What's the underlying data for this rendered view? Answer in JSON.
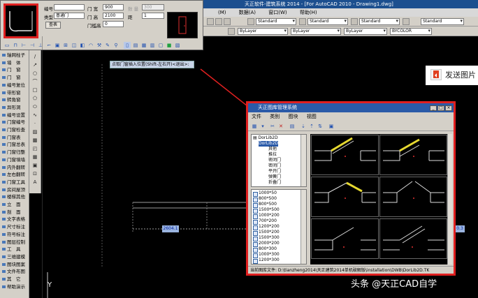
{
  "app": {
    "title": "天正软件-建筑系统 2014 - [For AutoCAD 2010 - Drawing1.dwg]"
  },
  "menu": [
    "(M)",
    "数据(A)",
    "窗口(W)",
    "帮助(H)"
  ],
  "toolbar": {
    "text_style": "Standard",
    "dim_style": "Standard",
    "table_style": "Standard",
    "multileader_style": "Standard",
    "layer": "ByLayer",
    "linetype": "ByLayer",
    "lineweight": "ByLayer",
    "color": "BYCOLOR"
  },
  "insert_dialog": {
    "number_label": "编号",
    "number_value": "",
    "type_label": "类型",
    "type_value": "普通门",
    "table_button": "查表",
    "width_label": "门 宽",
    "width_value": "900",
    "height_label": "门 高",
    "height_value": "2100",
    "sill_label": "门槛高",
    "sill_value": "0",
    "count_label": "数 量",
    "count_value": "300",
    "dist_label": "距",
    "dist_value": "1"
  },
  "palette": {
    "items": [
      "轴网柱子",
      "墙　体",
      "门　窗",
      "门　窗",
      "编号复位",
      "带形窗",
      "转角窗",
      "异形洞",
      "编号设置",
      "门窗编号",
      "门窗检查",
      "门窗表",
      "门窗总表",
      "门窗归整",
      "门窗填墙",
      "内外翻转",
      "左右翻转",
      "门窗工具",
      "房间屋顶",
      "楼梯其他",
      "立　面",
      "剖　面",
      "文字表格",
      "尺寸标注",
      "符号标注",
      "图层控制",
      "工　具",
      "三维建模",
      "图块图案",
      "文件布图",
      "其　它",
      "帮助演示"
    ]
  },
  "drawing": {
    "prompt": "点取门窗插入位置(Shift-左右开)<退出>:",
    "dim_left": "2604.1",
    "dim_right": "0.3",
    "axis_y": "Y"
  },
  "send_picture": "发送图片",
  "library": {
    "title": "天正图库管理系统",
    "menu": [
      "文件",
      "类别",
      "图块",
      "视图"
    ],
    "tree_root": "DorLib2D",
    "tree_sub": "DorLib2D",
    "tree_items": [
      "其他",
      "推拉",
      "密闭门",
      "密闭门",
      "平开门",
      "弹簧门",
      "折叠门",
      "推拉门"
    ],
    "list_items": [
      "1000*50",
      "800*500",
      "800*500",
      "1500*500",
      "1000*200",
      "700*200",
      "1200*200",
      "1500*200",
      "1500*300",
      "2000*200",
      "800*300",
      "1000*300",
      "1200*300"
    ],
    "status": "当前图库文件: D:\\tianzheng2014\\天正建筑2014单机破解版\\installation\\DWB\\DorLib2D.TK"
  },
  "watermark": "头条 @天正CAD自学"
}
